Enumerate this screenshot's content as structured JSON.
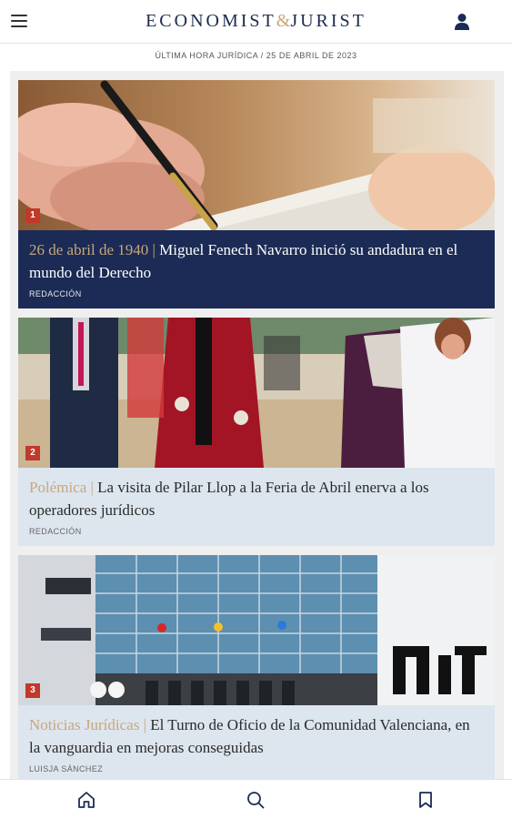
{
  "header": {
    "logo_left": "ECONOMIST",
    "logo_amp": "&",
    "logo_right": "JURIST",
    "menu_icon": "hamburger-menu-icon",
    "user_icon": "user-icon"
  },
  "subheader": {
    "text": "ÚLTIMA HORA JURÍDICA / 25 DE ABRIL DE 2023"
  },
  "articles": [
    {
      "rank": "1",
      "kicker": "26 de abril de 1940",
      "separator": "|",
      "title": "Miguel Fenech Navarro inició su andadura en el mundo del Derecho",
      "author": "REDACCIÓN",
      "image": "pen-signing-document-photo"
    },
    {
      "rank": "2",
      "kicker": "Polémica",
      "separator": "|",
      "title": "La visita de Pilar Llop a la Feria de Abril enerva a los operadores jurídicos",
      "author": "REDACCIÓN",
      "image": "feria-de-abril-flamenco-dresses-photo"
    },
    {
      "rank": "3",
      "kicker": "Noticias Jurídicas",
      "separator": "|",
      "title": "El Turno de Oficio de la Comunidad Valenciana, en la vanguardia en mejoras conseguidas",
      "author": "LUISJA SÁNCHEZ",
      "image": "ciutat-de-la-justicia-building-photo"
    }
  ],
  "nav": {
    "home_icon": "home-icon",
    "search_icon": "search-icon",
    "bookmark_icon": "bookmark-icon"
  },
  "colors": {
    "navy": "#1b2b55",
    "gold": "#c9a77a",
    "badge_red": "#c0392b",
    "light_card": "#dde5ef"
  }
}
